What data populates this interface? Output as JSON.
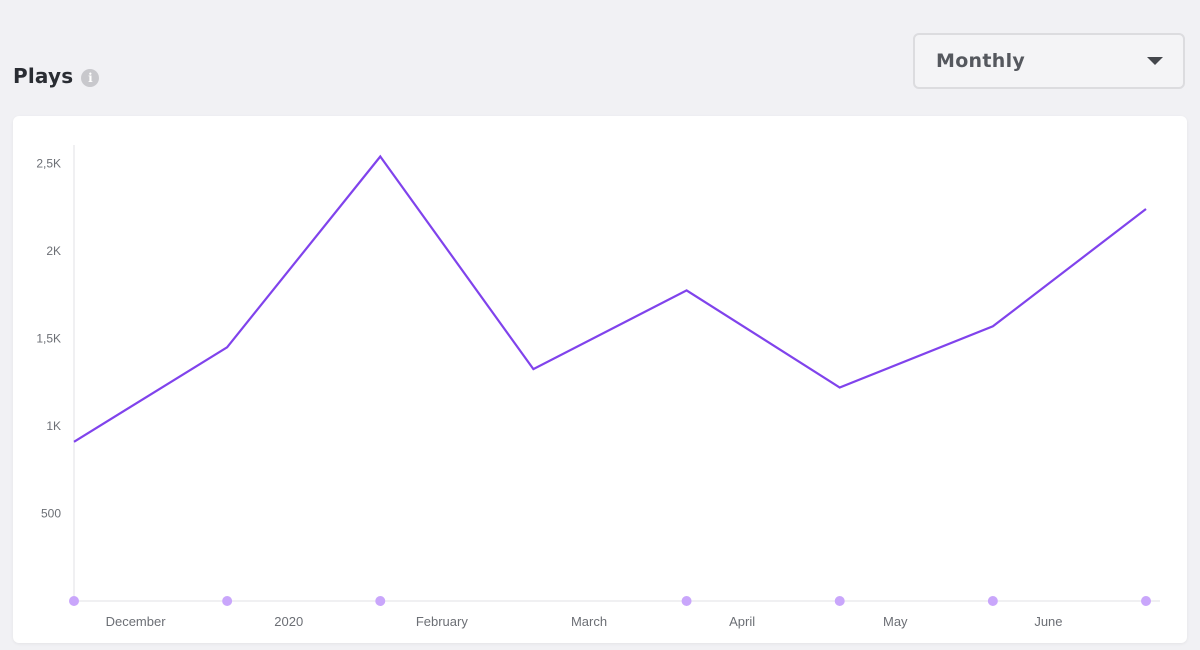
{
  "header": {
    "title": "Plays",
    "info_icon": "info-icon"
  },
  "dropdown": {
    "selected": "Monthly",
    "icon": "caret-down-icon"
  },
  "colors": {
    "line": "#8043ec",
    "marker": "#c9a6fb",
    "axis": "#e2e2e6",
    "label": "#6c6f75"
  },
  "chart_data": {
    "type": "line",
    "title": "Plays",
    "xlabel": "",
    "ylabel": "",
    "ylim": [
      0,
      2600
    ],
    "y_ticks": [
      {
        "value": 500,
        "label": "500"
      },
      {
        "value": 1000,
        "label": "1K"
      },
      {
        "value": 1500,
        "label": "1,5K"
      },
      {
        "value": 2000,
        "label": "2K"
      },
      {
        "value": 2500,
        "label": "2,5K"
      }
    ],
    "x_labels": [
      "December",
      "2020",
      "February",
      "March",
      "April",
      "May",
      "June"
    ],
    "points": [
      910,
      1450,
      2540,
      1325,
      1775,
      1220,
      1570,
      2240
    ],
    "markers": [
      0,
      1,
      2,
      4,
      5,
      6,
      7
    ],
    "grid": false,
    "legend": "none"
  }
}
